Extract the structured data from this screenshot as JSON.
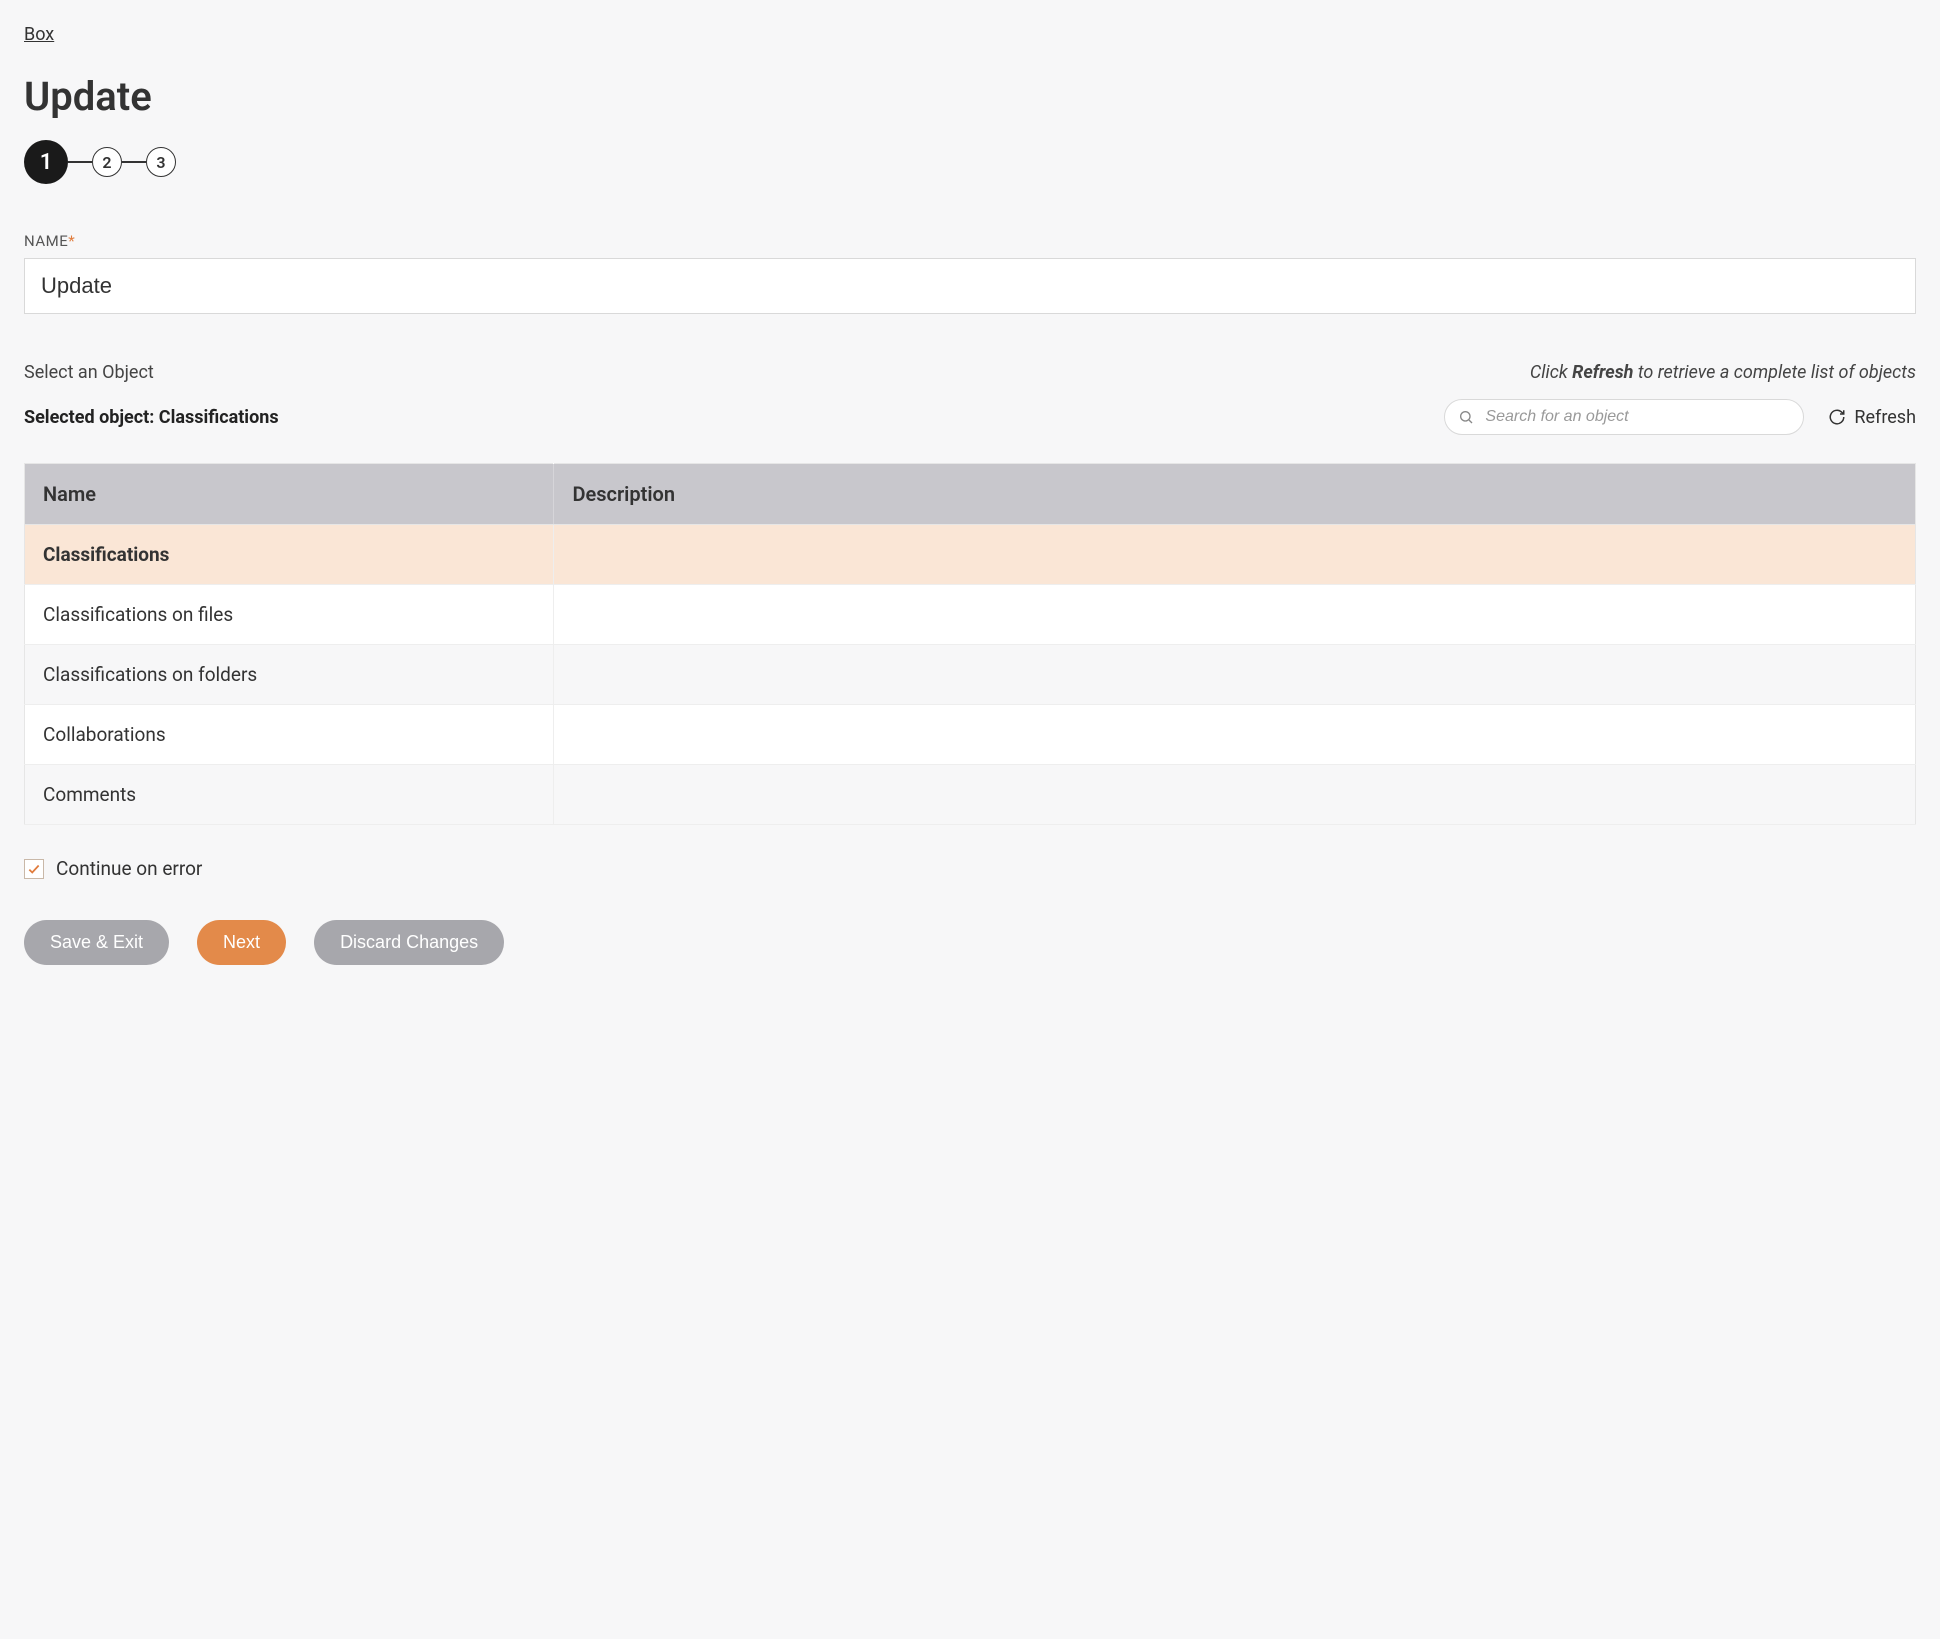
{
  "breadcrumb": "Box",
  "page_title": "Update",
  "stepper": {
    "steps": [
      "1",
      "2",
      "3"
    ],
    "active_index": 0
  },
  "name_field": {
    "label": "NAME",
    "required_marker": "*",
    "value": "Update"
  },
  "object_section": {
    "select_label": "Select an Object",
    "hint_prefix": "Click ",
    "hint_bold": "Refresh",
    "hint_suffix": " to retrieve a complete list of objects",
    "selected_prefix": "Selected object: ",
    "selected_value": "Classifications",
    "search_placeholder": "Search for an object",
    "refresh_label": "Refresh"
  },
  "table": {
    "headers": {
      "name": "Name",
      "description": "Description"
    },
    "rows": [
      {
        "name": "Classifications",
        "description": "",
        "selected": true,
        "alt": false
      },
      {
        "name": "Classifications on files",
        "description": "",
        "selected": false,
        "alt": false
      },
      {
        "name": "Classifications on folders",
        "description": "",
        "selected": false,
        "alt": true
      },
      {
        "name": "Collaborations",
        "description": "",
        "selected": false,
        "alt": false
      },
      {
        "name": "Comments",
        "description": "",
        "selected": false,
        "alt": true
      }
    ]
  },
  "continue_on_error": {
    "label": "Continue on error",
    "checked": true
  },
  "buttons": {
    "save_exit": "Save & Exit",
    "next": "Next",
    "discard": "Discard Changes"
  }
}
